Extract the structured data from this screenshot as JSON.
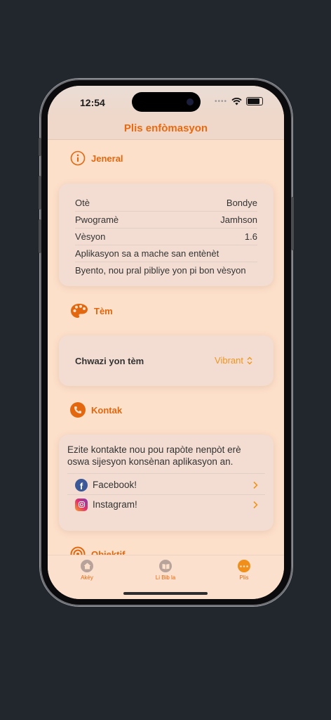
{
  "status": {
    "time": "12:54"
  },
  "nav": {
    "title": "Plis enfòmasyon"
  },
  "general": {
    "title": "Jeneral",
    "rows": [
      {
        "label": "Otè",
        "value": "Bondye"
      },
      {
        "label": "Pwogramè",
        "value": "Jamhson"
      },
      {
        "label": "Vèsyon",
        "value": "1.6"
      }
    ],
    "note1": "Aplikasyon sa a mache san entènèt",
    "note2": "Byento, nou pral pibliye yon pi bon vèsyon"
  },
  "theme": {
    "title": "Tèm",
    "choose_label": "Chwazi yon tèm",
    "selected": "Vibrant"
  },
  "contact": {
    "title": "Kontak",
    "description": "Ezite kontakte nou pou rapòte nenpòt erè oswa sijesyon konsènan aplikasyon an.",
    "facebook": "Facebook!",
    "instagram": "Instagram!"
  },
  "objective": {
    "title": "Objektif"
  },
  "tabs": [
    {
      "label": "Akèy"
    },
    {
      "label": "Li Bib la"
    },
    {
      "label": "Plis"
    }
  ],
  "colors": {
    "accent": "#e96a0f",
    "background": "#fde0ca",
    "card": "#f3ddd2"
  }
}
